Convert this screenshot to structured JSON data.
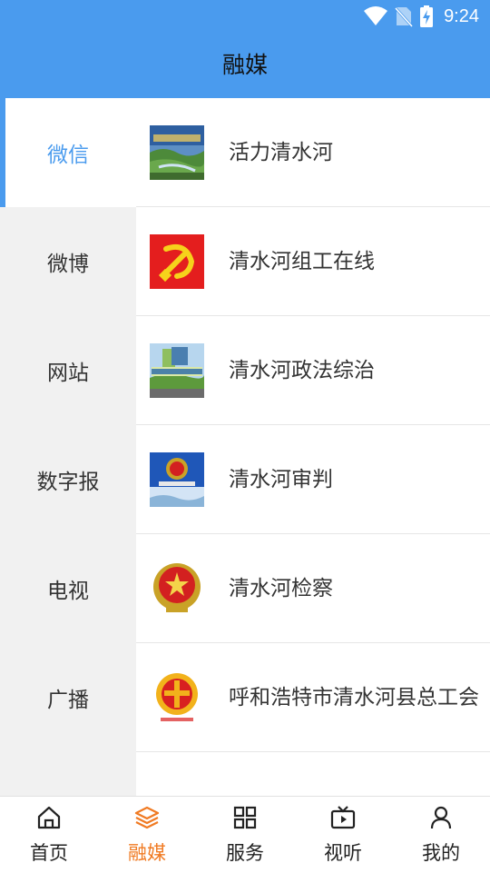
{
  "status_bar": {
    "time": "9:24",
    "icons": [
      "wifi-icon",
      "no-sim-icon",
      "battery-charging-icon"
    ]
  },
  "header": {
    "title": "融媒"
  },
  "sidebar": {
    "items": [
      {
        "label": "微信",
        "active": true
      },
      {
        "label": "微博"
      },
      {
        "label": "网站"
      },
      {
        "label": "数字报"
      },
      {
        "label": "电视"
      },
      {
        "label": "广播"
      }
    ]
  },
  "content": {
    "items": [
      {
        "label": "活力清水河",
        "icon": "landscape-photo-icon"
      },
      {
        "label": "清水河组工在线",
        "icon": "party-emblem-icon"
      },
      {
        "label": "清水河政法综治",
        "icon": "great-wall-photo-icon"
      },
      {
        "label": "清水河审判",
        "icon": "court-emblem-icon"
      },
      {
        "label": "清水河检察",
        "icon": "procuratorate-emblem-icon"
      },
      {
        "label": "呼和浩特市清水河县总工会",
        "icon": "trade-union-logo-icon"
      },
      {
        "label": "",
        "icon": "youth-league-emblem-icon"
      }
    ]
  },
  "tabbar": {
    "tabs": [
      {
        "label": "首页",
        "icon": "home-icon"
      },
      {
        "label": "融媒",
        "icon": "layers-icon",
        "active": true
      },
      {
        "label": "服务",
        "icon": "grid-icon"
      },
      {
        "label": "视听",
        "icon": "video-icon"
      },
      {
        "label": "我的",
        "icon": "user-icon"
      }
    ]
  },
  "colors": {
    "header": "#4a9bee",
    "active_sidebar": "#4a9bee",
    "active_tab": "#f07a22",
    "sidebar_bg": "#f1f1f1"
  }
}
